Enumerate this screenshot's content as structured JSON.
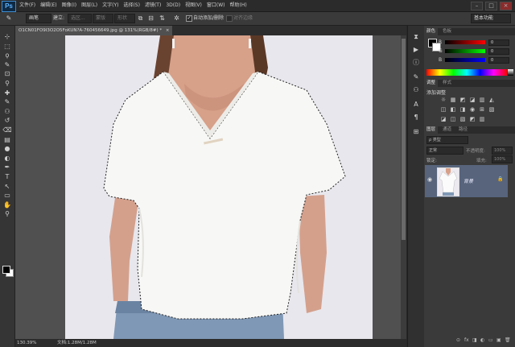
{
  "app": {
    "logo": "Ps"
  },
  "menu": [
    "文件(F)",
    "编辑(E)",
    "图像(I)",
    "图层(L)",
    "文字(Y)",
    "选择(S)",
    "滤镜(T)",
    "3D(D)",
    "视图(V)",
    "窗口(W)",
    "帮助(H)"
  ],
  "window_controls": {
    "minimize": "–",
    "maximize": "□",
    "close": "×"
  },
  "options": {
    "tool_preset": "✎",
    "mode_label": "画笔",
    "mode_select": "建立:",
    "select_btn": "选区...",
    "mask_btn": "蒙版",
    "shape_btn": "形状",
    "auto_add_delete": "自动添加/删除",
    "align_edges": "对齐边缘",
    "auto_checked": true,
    "workspace": "基本功能"
  },
  "document": {
    "tab_title": "O1CN01FO9I3O2O5FoKUN?A-760456649.jpg @ 131%(RGB/8#) *",
    "tab_close": "×"
  },
  "status": {
    "zoom": "130.39%",
    "doc_size": "文档:1.28M/1.28M"
  },
  "toolbar": {
    "icons": [
      "move-tool-icon",
      "marquee-tool-icon",
      "lasso-tool-icon",
      "quick-select-icon",
      "crop-tool-icon",
      "eyedropper-icon",
      "healing-brush-icon",
      "brush-tool-icon",
      "clone-stamp-icon",
      "history-brush-icon",
      "eraser-icon",
      "gradient-icon",
      "blur-icon",
      "dodge-icon",
      "pen-tool-icon",
      "type-tool-icon",
      "path-select-icon",
      "shape-tool-icon",
      "hand-tool-icon",
      "zoom-tool-icon"
    ],
    "glyphs": [
      "⊹",
      "⬚",
      "ϙ",
      "✎",
      "⊡",
      "⚲",
      "✚",
      "✎",
      "⚇",
      "↺",
      "⌫",
      "▤",
      "●",
      "◐",
      "✒",
      "T",
      "↖",
      "▭",
      "✋",
      "⚲"
    ]
  },
  "color_panel": {
    "tabs": [
      "颜色",
      "色板"
    ],
    "rows": [
      {
        "label": "R",
        "value": "0"
      },
      {
        "label": "G",
        "value": "0"
      },
      {
        "label": "B",
        "value": "0"
      }
    ]
  },
  "adjust_panel": {
    "tabs": [
      "调整",
      "样式"
    ],
    "title": "添加调整",
    "row1": [
      "☼",
      "▦",
      "◩",
      "◪",
      "▥",
      "◭"
    ],
    "row2": [
      "◫",
      "◧",
      "◨",
      "◉",
      "⊞",
      "▧"
    ],
    "row3": [
      "◪",
      "◫",
      "▧",
      "◩",
      "▥"
    ]
  },
  "layers_panel": {
    "tabs": [
      "图层",
      "通道",
      "路径"
    ],
    "kind": "ρ 类型",
    "blend": "正常",
    "opacity_label": "不透明度:",
    "opacity": "100%",
    "lock_label": "锁定:",
    "fill_label": "填充:",
    "fill": "100%",
    "layer_name": "背景",
    "lock_icon": "🔒",
    "eye": "◉"
  },
  "panel_footer": [
    "⊙",
    "fx",
    "◨",
    "◐",
    "▭",
    "▣",
    "🗑"
  ]
}
